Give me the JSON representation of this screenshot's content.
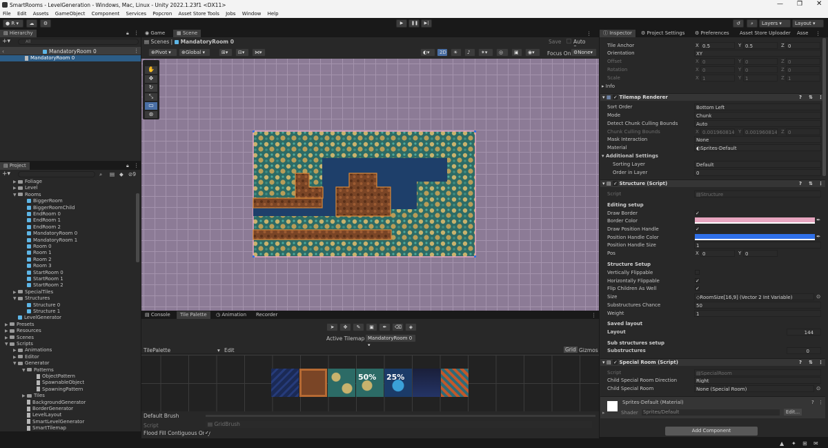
{
  "window": {
    "title": "SmartRooms - LevelGeneration - Windows, Mac, Linux - Unity 2022.1.23f1 <DX11>"
  },
  "menu": [
    "File",
    "Edit",
    "Assets",
    "GameObject",
    "Component",
    "Services",
    "Popcron",
    "Asset Store Tools",
    "Jobs",
    "Window",
    "Help"
  ],
  "toolbar": {
    "account": "R",
    "layers": "Layers",
    "layout": "Layout"
  },
  "hierarchy": {
    "tab": "Hierarchy",
    "search_placeholder": "All",
    "scene_header": "MandatoryRoom 0",
    "items": [
      "MandatoryRoom 0"
    ]
  },
  "project": {
    "tab": "Project",
    "hidden_count": "9",
    "tree": [
      {
        "label": "Foliage",
        "type": "folder",
        "depth": 1,
        "arrow": "▶"
      },
      {
        "label": "Level",
        "type": "folder",
        "depth": 1,
        "arrow": "▶"
      },
      {
        "label": "Rooms",
        "type": "folder",
        "depth": 1,
        "arrow": "▼"
      },
      {
        "label": "BiggerRoom",
        "type": "prefab",
        "depth": 2,
        "arrow": ""
      },
      {
        "label": "BiggerRoomChild",
        "type": "prefab",
        "depth": 2,
        "arrow": ""
      },
      {
        "label": "EndRoom 0",
        "type": "prefab",
        "depth": 2,
        "arrow": ""
      },
      {
        "label": "EndRoom 1",
        "type": "prefab",
        "depth": 2,
        "arrow": ""
      },
      {
        "label": "EndRoom 2",
        "type": "prefab",
        "depth": 2,
        "arrow": ""
      },
      {
        "label": "MandatoryRoom 0",
        "type": "prefab",
        "depth": 2,
        "arrow": ""
      },
      {
        "label": "MandatoryRoom 1",
        "type": "prefab",
        "depth": 2,
        "arrow": ""
      },
      {
        "label": "Room 0",
        "type": "prefab",
        "depth": 2,
        "arrow": ""
      },
      {
        "label": "Room 1",
        "type": "prefab",
        "depth": 2,
        "arrow": ""
      },
      {
        "label": "Room 2",
        "type": "prefab",
        "depth": 2,
        "arrow": ""
      },
      {
        "label": "Room 3",
        "type": "prefab",
        "depth": 2,
        "arrow": ""
      },
      {
        "label": "StartRoom 0",
        "type": "prefab",
        "depth": 2,
        "arrow": ""
      },
      {
        "label": "StartRoom 1",
        "type": "prefab",
        "depth": 2,
        "arrow": ""
      },
      {
        "label": "StartRoom 2",
        "type": "prefab",
        "depth": 2,
        "arrow": ""
      },
      {
        "label": "SpecialTiles",
        "type": "folder",
        "depth": 1,
        "arrow": "▶"
      },
      {
        "label": "Structures",
        "type": "folder",
        "depth": 1,
        "arrow": "▼"
      },
      {
        "label": "Structure 0",
        "type": "prefab",
        "depth": 2,
        "arrow": ""
      },
      {
        "label": "Structure 1",
        "type": "prefab",
        "depth": 2,
        "arrow": ""
      },
      {
        "label": "LevelGenerator",
        "type": "prefab",
        "depth": 1,
        "arrow": ""
      },
      {
        "label": "Presets",
        "type": "folder",
        "depth": 0,
        "arrow": "▶"
      },
      {
        "label": "Resources",
        "type": "folder",
        "depth": 0,
        "arrow": "▶"
      },
      {
        "label": "Scenes",
        "type": "folder",
        "depth": 0,
        "arrow": "▶"
      },
      {
        "label": "Scripts",
        "type": "folder",
        "depth": 0,
        "arrow": "▼"
      },
      {
        "label": "Animations",
        "type": "folder",
        "depth": 1,
        "arrow": "▶"
      },
      {
        "label": "Editor",
        "type": "folder",
        "depth": 1,
        "arrow": "▶"
      },
      {
        "label": "Generator",
        "type": "folder",
        "depth": 1,
        "arrow": "▼"
      },
      {
        "label": "Patterns",
        "type": "folder",
        "depth": 2,
        "arrow": "▼"
      },
      {
        "label": "ObjectPattern",
        "type": "file",
        "depth": 3,
        "arrow": ""
      },
      {
        "label": "SpawnableObject",
        "type": "file",
        "depth": 3,
        "arrow": ""
      },
      {
        "label": "SpawningPattern",
        "type": "file",
        "depth": 3,
        "arrow": ""
      },
      {
        "label": "Tiles",
        "type": "folder",
        "depth": 2,
        "arrow": "▶"
      },
      {
        "label": "BackgroundGenerator",
        "type": "file",
        "depth": 2,
        "arrow": ""
      },
      {
        "label": "BorderGenerator",
        "type": "file",
        "depth": 2,
        "arrow": ""
      },
      {
        "label": "LevelLayout",
        "type": "file",
        "depth": 2,
        "arrow": ""
      },
      {
        "label": "SmartLevelGenerator",
        "type": "file",
        "depth": 2,
        "arrow": ""
      },
      {
        "label": "SmartTilemap",
        "type": "file",
        "depth": 2,
        "arrow": ""
      }
    ]
  },
  "scene": {
    "tabs": [
      "Game",
      "Scene"
    ],
    "breadcrumb_root": "Scenes",
    "breadcrumb_item": "MandatoryRoom 0",
    "save": "Save",
    "auto_save": "Auto Save",
    "pivot": "Pivot",
    "global": "Global",
    "mode_2d": "2D",
    "focus_on": "Focus On",
    "focus_value": "None"
  },
  "palette": {
    "tabs": [
      "Console",
      "Tile Palette",
      "Animation",
      "Recorder"
    ],
    "active_tilemap_label": "Active Tilemap",
    "active_tilemap_value": "MandatoryRoom 0",
    "palette_name": "TilePalette",
    "edit": "Edit",
    "grid": "Grid",
    "gizmos": "Gizmos",
    "tile_labels": [
      "",
      "",
      "",
      "50%",
      "25%",
      "",
      ""
    ],
    "brush": "Default Brush",
    "script_label": "Script",
    "script_value": "GridBrush",
    "flood_fill": "Flood Fill Contiguous Only"
  },
  "inspector": {
    "tabs": [
      "Inspector",
      "Project Settings",
      "Preferences",
      "Asset Store Uploader",
      "Asse"
    ],
    "tile_anchor": {
      "label": "Tile Anchor",
      "x": "0.5",
      "y": "0.5",
      "z": "0"
    },
    "orientation": {
      "label": "Orientation",
      "value": "XY"
    },
    "offset": {
      "label": "Offset",
      "x": "0",
      "y": "0",
      "z": "0"
    },
    "rotation": {
      "label": "Rotation",
      "x": "0",
      "y": "0",
      "z": "0"
    },
    "scale": {
      "label": "Scale",
      "x": "1",
      "y": "1",
      "z": "1"
    },
    "info": "Info",
    "tilemap_renderer": {
      "title": "Tilemap Renderer",
      "sort_order": {
        "label": "Sort Order",
        "value": "Bottom Left"
      },
      "mode": {
        "label": "Mode",
        "value": "Chunk"
      },
      "detect": {
        "label": "Detect Chunk Culling Bounds",
        "value": "Auto"
      },
      "culling": {
        "label": "Chunk Culling Bounds",
        "x": "0.001960814",
        "y": "0.001960814",
        "z": "0"
      },
      "mask": {
        "label": "Mask Interaction",
        "value": "None"
      },
      "material": {
        "label": "Material",
        "value": "Sprites-Default"
      },
      "additional": "Additional Settings",
      "sorting_layer": {
        "label": "Sorting Layer",
        "value": "Default"
      },
      "order_in_layer": {
        "label": "Order in Layer",
        "value": "0"
      }
    },
    "structure": {
      "title": "Structure (Script)",
      "script": {
        "label": "Script",
        "value": "Structure"
      },
      "editing_setup": "Editing setup",
      "draw_border": "Draw Border",
      "border_color": "Border Color",
      "draw_position_handle": "Draw Position Handle",
      "position_handle_color": "Position Handle Color",
      "position_handle_size": {
        "label": "Position Handle Size",
        "value": "1"
      },
      "pos": {
        "label": "Pos",
        "x": "0",
        "y": "0"
      },
      "structure_setup": "Structure Setup",
      "vertically_flippable": "Vertically Flippable",
      "horizontally_flippable": "Horizontally Flippable",
      "flip_children": "Flip Children As Well",
      "size": {
        "label": "Size",
        "value": "RoomSize[16,9] (Vector 2 Int Variable)"
      },
      "substructures_chance": {
        "label": "Substructures Chance",
        "value": "50"
      },
      "weight": {
        "label": "Weight",
        "value": "1"
      },
      "saved_layout": "Saved layout",
      "layout": {
        "label": "Layout",
        "value": "144"
      },
      "sub_setup": "Sub structures setup",
      "substructures": {
        "label": "Substructures",
        "value": "0"
      }
    },
    "special_room": {
      "title": "Special Room (Script)",
      "script": {
        "label": "Script",
        "value": "SpecialRoom"
      },
      "direction": {
        "label": "Child Special Room Direction",
        "value": "Right"
      },
      "child": {
        "label": "Child Special Room",
        "value": "None (Special Room)"
      }
    },
    "material": {
      "name": "Sprites-Default (Material)",
      "shader_label": "Shader",
      "shader_value": "Sprites/Default",
      "edit": "Edit..."
    },
    "add_component": "Add Component"
  },
  "colors": {
    "border_color": "#e8a6c0",
    "position_handle_color": "#2f6fe8",
    "prefab": "#5eb6e6",
    "selection": "#2c5d87"
  }
}
